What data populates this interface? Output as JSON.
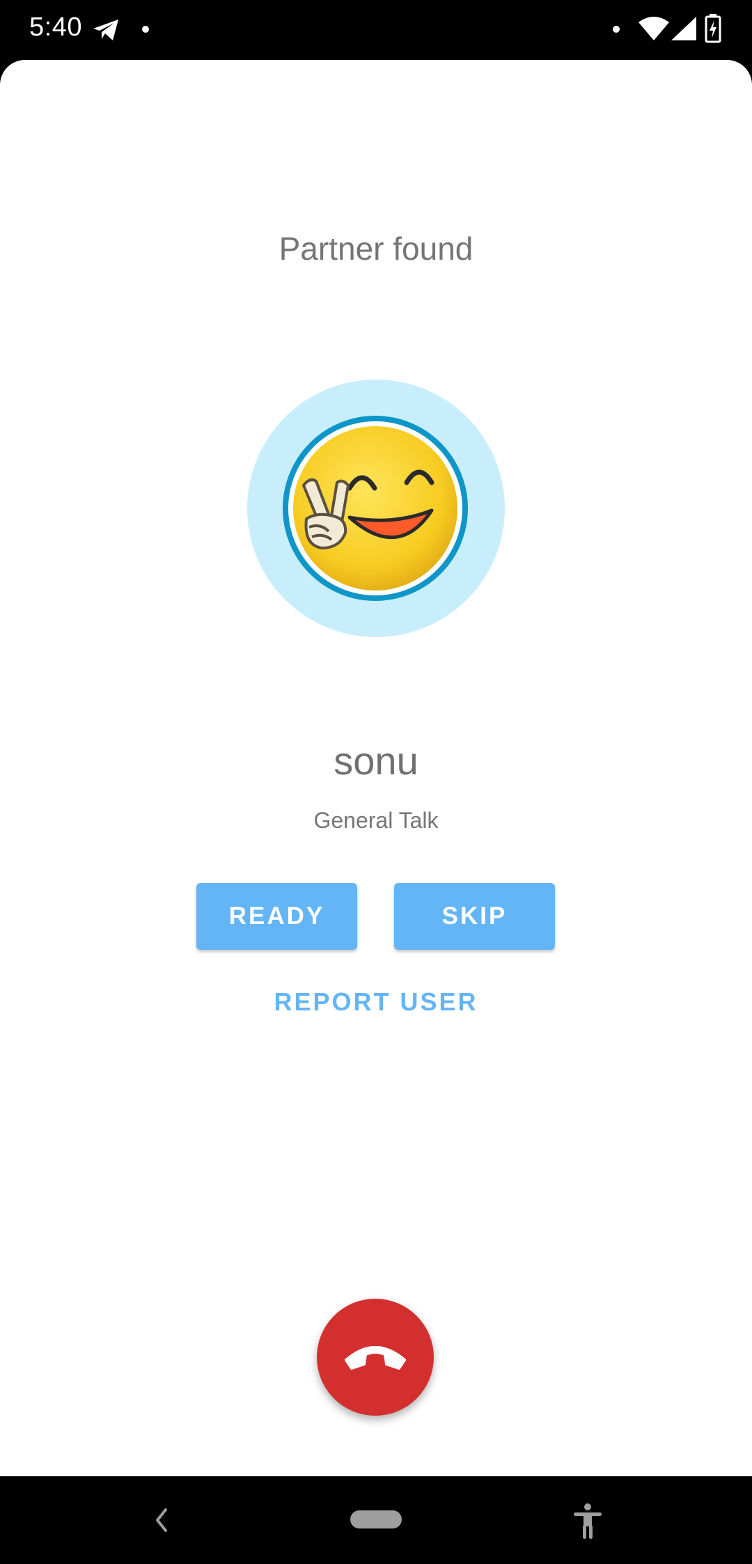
{
  "status_bar": {
    "time": "5:40",
    "icons": [
      "telegram-icon",
      "notification-dot-icon",
      "wifi-icon",
      "signal-icon",
      "battery-charging-icon"
    ]
  },
  "call": {
    "heading": "Partner found",
    "username": "sonu",
    "topic": "General Talk",
    "ready_label": "READY",
    "skip_label": "SKIP",
    "report_label": "REPORT USER",
    "avatar_icon": "peace-smiley-emoji",
    "hangup_icon": "phone-hangup-icon"
  },
  "nav_bar": {
    "back_icon": "back-chevron-icon",
    "home_icon": "home-pill-icon",
    "accessibility_icon": "accessibility-icon"
  },
  "colors": {
    "accent": "#64b5f6",
    "halo": "#c9eefb",
    "ring": "#0e96c8",
    "hangup": "#d32f2f"
  }
}
